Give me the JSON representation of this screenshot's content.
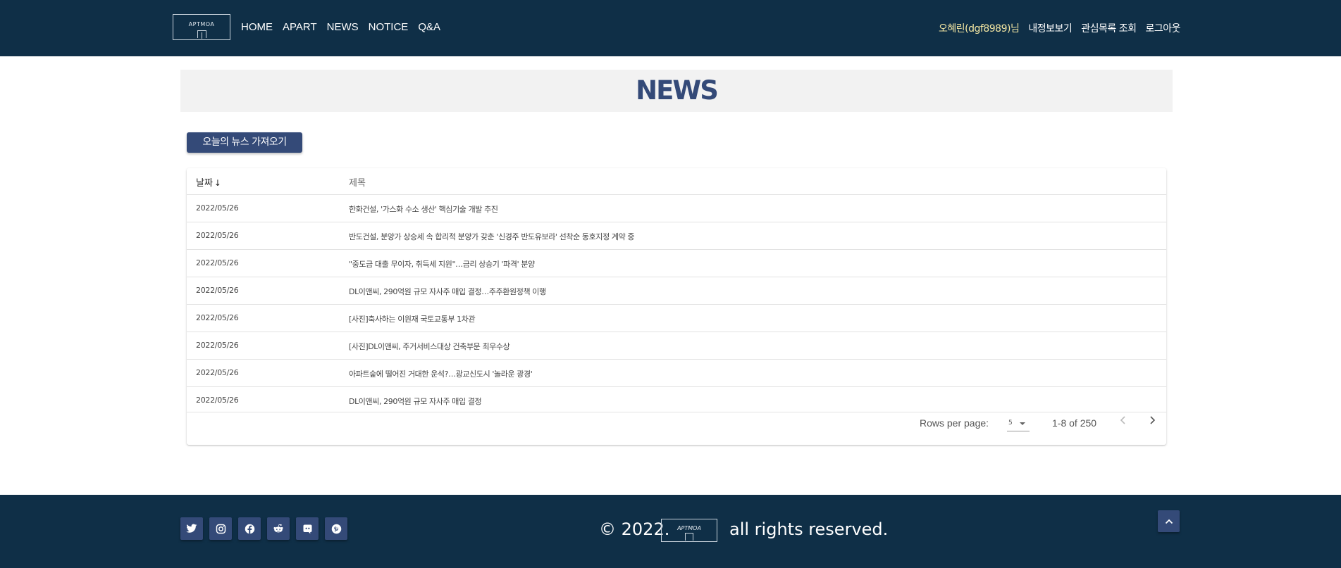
{
  "header": {
    "logo_text": "APTMOA",
    "nav": [
      "HOME",
      "APART",
      "NEWS",
      "NOTICE",
      "Q&A"
    ],
    "user_label": "오혜린(dgf8989)님",
    "user_links": [
      "내정보보기",
      "관심목록 조회",
      "로그아웃"
    ]
  },
  "banner": {
    "title": "NEWS"
  },
  "fetch_button": "오늘의 뉴스 가져오기",
  "table": {
    "headers": {
      "date": "날짜",
      "date_sort_icon": "↓",
      "title": "제목"
    },
    "rows": [
      {
        "date": "2022/05/26",
        "title": "한화건설, '가스화 수소 생산' 핵심기술 개발 추진"
      },
      {
        "date": "2022/05/26",
        "title": "반도건설, 분양가 상승세 속 합리적 분양가 갖춘 '신경주 반도유보라' 선착순 동호지정 계약 중"
      },
      {
        "date": "2022/05/26",
        "title": "\"중도금 대출 무이자, 취득세 지원\"…금리 상승기 '파격' 분양"
      },
      {
        "date": "2022/05/26",
        "title": "DL이앤씨, 290억원 규모 자사주 매입 결정…주주환원정책 이행"
      },
      {
        "date": "2022/05/26",
        "title": "[사진]축사하는 이원재 국토교통부 1차관"
      },
      {
        "date": "2022/05/26",
        "title": "[사진]DL이앤씨, 주거서비스대상 건축부문 최우수상"
      },
      {
        "date": "2022/05/26",
        "title": "아파트숲에 떨어진 거대한 운석?…광교신도시 '놀라운 광경'"
      },
      {
        "date": "2022/05/26",
        "title": "DL이앤씨, 290억원 규모 자사주 매입 결정"
      }
    ],
    "pagination": {
      "rows_per_page_label": "Rows per page:",
      "rows_per_page_value": "5",
      "range": "1-8 of 250",
      "prev_icon": "chevron-left-icon",
      "next_icon": "chevron-right-icon"
    }
  },
  "footer": {
    "social_icons": [
      "twitter-icon",
      "instagram-icon",
      "facebook-icon",
      "reddit-icon",
      "discord-icon",
      "pinterest-icon"
    ],
    "copyright_prefix": "© 2022.",
    "copyright_suffix": "all rights reserved.",
    "logo_text": "APTMOA",
    "scroll_top_icon": "chevron-up-icon"
  },
  "colors": {
    "header_bg": "#0f2f47",
    "accent": "#344a78",
    "user_highlight": "#f3e6a2",
    "banner_bg": "#f2f2f2"
  }
}
